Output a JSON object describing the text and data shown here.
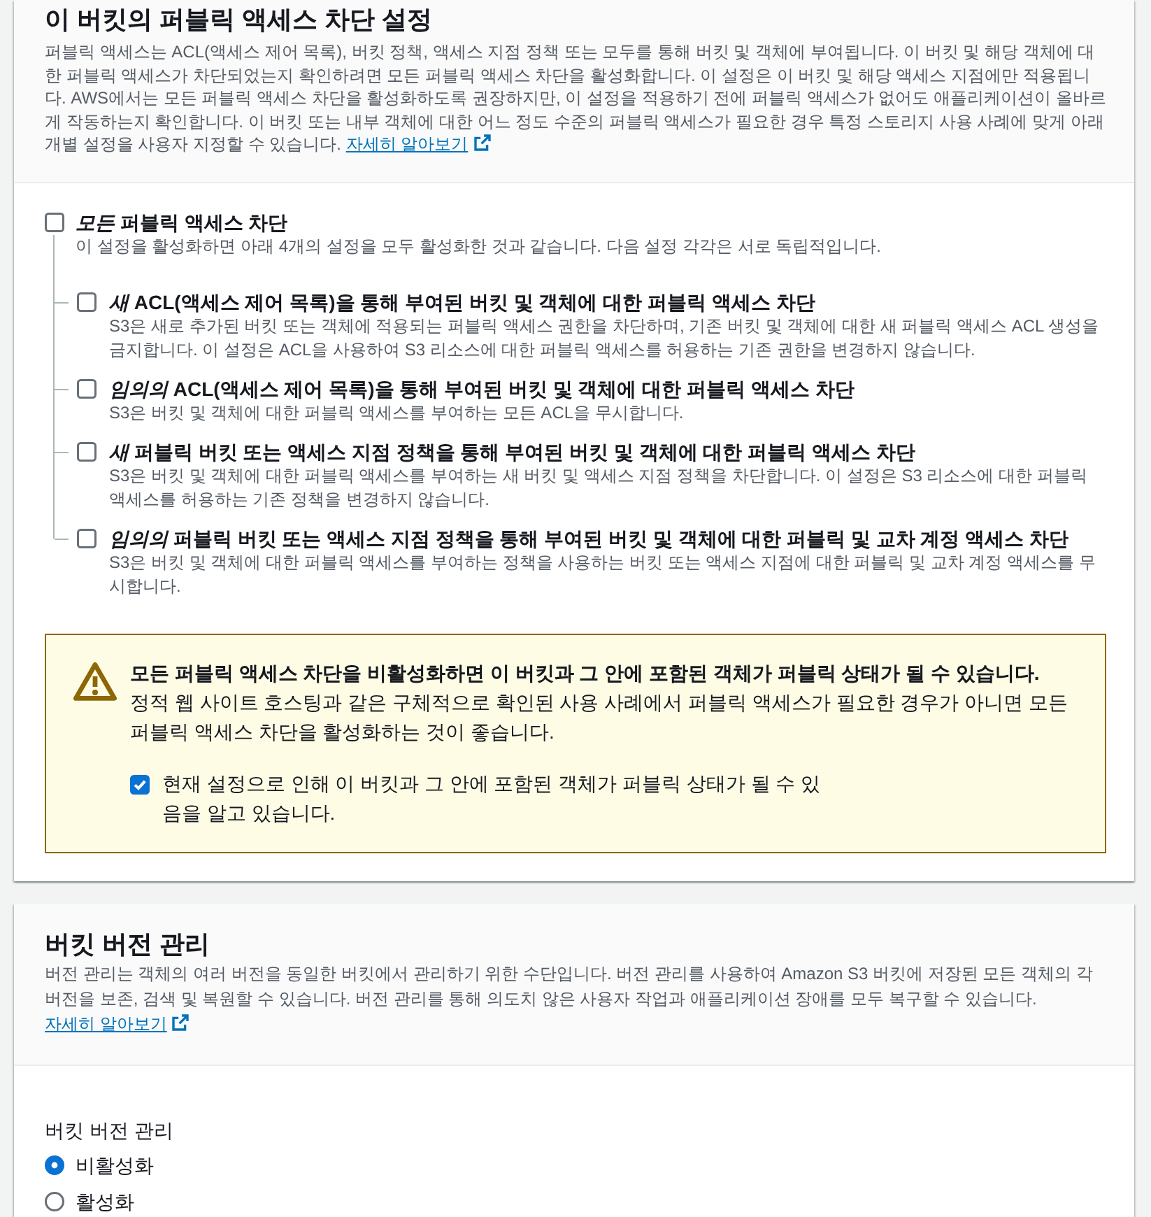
{
  "public_access_block": {
    "title": "이 버킷의 퍼블릭 액세스 차단 설정",
    "description": "퍼블릭 액세스는 ACL(액세스 제어 목록), 버킷 정책, 액세스 지점 정책 또는 모두를 통해 버킷 및 객체에 부여됩니다. 이 버킷 및 해당 객체에 대한 퍼블릭 액세스가 차단되었는지 확인하려면 모든 퍼블릭 액세스 차단을 활성화합니다. 이 설정은 이 버킷 및 해당 액세스 지점에만 적용됩니다. AWS에서는 모든 퍼블릭 액세스 차단을 활성화하도록 권장하지만, 이 설정을 적용하기 전에 퍼블릭 액세스가 없어도 애플리케이션이 올바르게 작동하는지 확인합니다. 이 버킷 또는 내부 객체에 대한 어느 정도 수준의 퍼블릭 액세스가 필요한 경우 특정 스토리지 사용 사례에 맞게 아래 개별 설정을 사용자 지정할 수 있습니다.",
    "learn_more_link": "자세히 알아보기",
    "block_all": {
      "label": "*모든* 퍼블릭 액세스 차단",
      "checked": false,
      "description": "이 설정을 활성화하면 아래 4개의 설정을 모두 활성화한 것과 같습니다. 다음 설정 각각은 서로 독립적입니다.",
      "children": [
        {
          "label": "*새* ACL(액세스 제어 목록)을 통해 부여된 버킷 및 객체에 대한 퍼블릭 액세스 차단",
          "checked": false,
          "description": "S3은 새로 추가된 버킷 또는 객체에 적용되는 퍼블릭 액세스 권한을 차단하며, 기존 버킷 및 객체에 대한 새 퍼블릭 액세스 ACL 생성을 금지합니다. 이 설정은 ACL을 사용하여 S3 리소스에 대한 퍼블릭 액세스를 허용하는 기존 권한을 변경하지 않습니다."
        },
        {
          "label": "*임의의* ACL(액세스 제어 목록)을 통해 부여된 버킷 및 객체에 대한 퍼블릭 액세스 차단",
          "checked": false,
          "description": "S3은 버킷 및 객체에 대한 퍼블릭 액세스를 부여하는 모든 ACL을 무시합니다."
        },
        {
          "label": "*새* 퍼블릭 버킷 또는 액세스 지점 정책을 통해 부여된 버킷 및 객체에 대한 퍼블릭 액세스 차단",
          "checked": false,
          "description": "S3은 버킷 및 객체에 대한 퍼블릭 액세스를 부여하는 새 버킷 및 액세스 지점 정책을 차단합니다. 이 설정은 S3 리소스에 대한 퍼블릭 액세스를 허용하는 기존 정책을 변경하지 않습니다."
        },
        {
          "label": "*임의의* 퍼블릭 버킷 또는 액세스 지점 정책을 통해 부여된 버킷 및 객체에 대한 퍼블릭 및 교차 계정 액세스 차단",
          "checked": false,
          "description": "S3은 버킷 및 객체에 대한 퍼블릭 액세스를 부여하는 정책을 사용하는 버킷 또는 액세스 지점에 대한 퍼블릭 및 교차 계정 액세스를 무시합니다."
        }
      ]
    },
    "warning": {
      "title": "모든 퍼블릭 액세스 차단을 비활성화하면 이 버킷과 그 안에 포함된 객체가 퍼블릭 상태가 될 수 있습니다.",
      "message": "정적 웹 사이트 호스팅과 같은 구체적으로 확인된 사용 사례에서 퍼블릭 액세스가 필요한 경우가 아니면 모든 퍼블릭 액세스 차단을 활성화하는 것이 좋습니다.",
      "acknowledgement": {
        "label": "현재 설정으로 인해 이 버킷과 그 안에 포함된 객체가 퍼블릭 상태가 될 수 있음을 알고 있습니다.",
        "checked": true
      }
    }
  },
  "bucket_versioning": {
    "title": "버킷 버전 관리",
    "description": "버전 관리는 객체의 여러 버전을 동일한 버킷에서 관리하기 위한 수단입니다. 버전 관리를 사용하여 Amazon S3 버킷에 저장된 모든 객체의 각 버전을 보존, 검색 및 복원할 수 있습니다. 버전 관리를 통해 의도치 않은 사용자 작업과 애플리케이션 장애를 모두 복구할 수 있습니다.",
    "learn_more_link": "자세히 알아보기",
    "versioning_field": {
      "label": "버킷 버전 관리",
      "options": [
        {
          "label": "비활성화",
          "selected": true
        },
        {
          "label": "활성화",
          "selected": false
        }
      ]
    }
  }
}
